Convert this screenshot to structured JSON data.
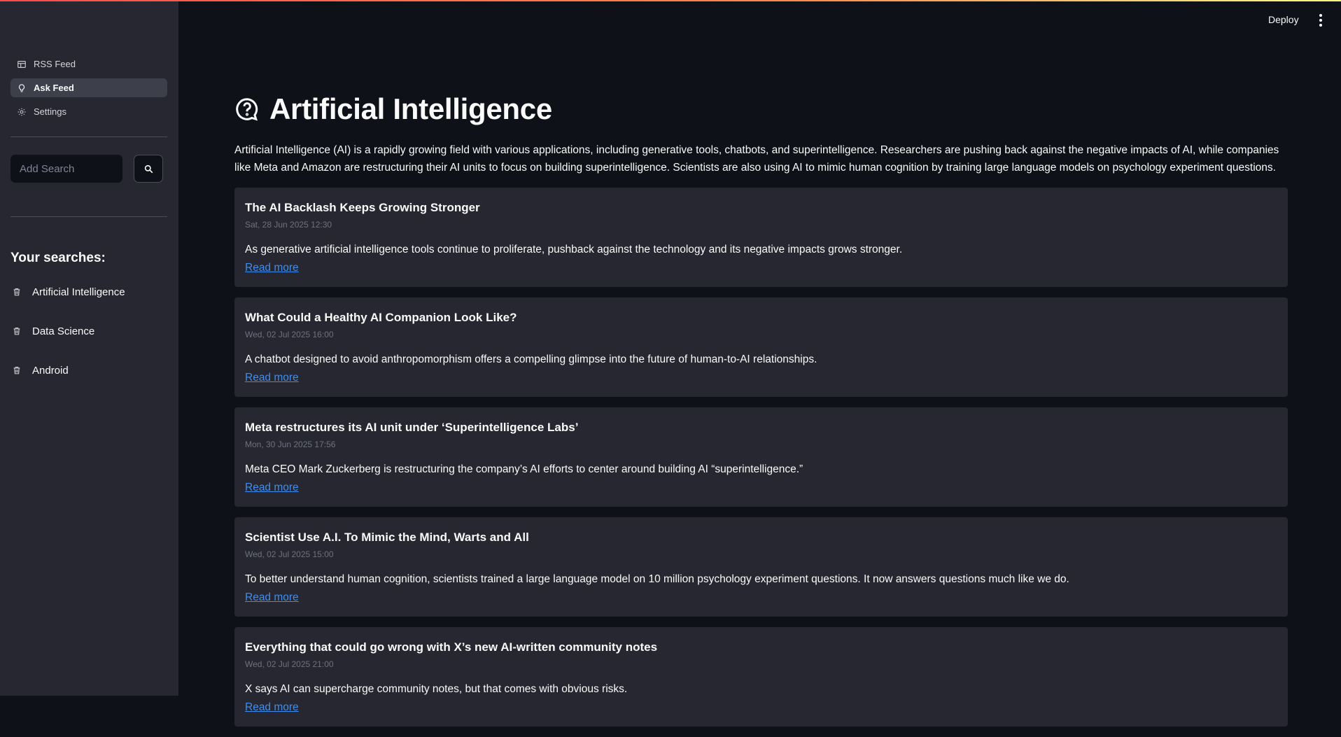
{
  "nav": {
    "items": [
      {
        "label": "RSS Feed",
        "icon": "table-icon",
        "active": false
      },
      {
        "label": "Ask Feed",
        "icon": "lightbulb-icon",
        "active": true
      },
      {
        "label": "Settings",
        "icon": "gear-icon",
        "active": false
      }
    ]
  },
  "search": {
    "placeholder": "Add Search",
    "value": ""
  },
  "sidebar": {
    "your_searches_heading": "Your searches:",
    "searches": [
      "Artificial Intelligence",
      "Data Science",
      "Android"
    ]
  },
  "header": {
    "deploy_label": "Deploy"
  },
  "main": {
    "title": "Artificial Intelligence",
    "summary": "Artificial Intelligence (AI) is a rapidly growing field with various applications, including generative tools, chatbots, and superintelligence. Researchers are pushing back against the negative impacts of AI, while companies like Meta and Amazon are restructuring their AI units to focus on building superintelligence. Scientists are also using AI to mimic human cognition by training large language models on psychology experiment questions.",
    "read_more_label": "Read more",
    "articles": [
      {
        "title": "The AI Backlash Keeps Growing Stronger",
        "date": "Sat, 28 Jun 2025 12:30",
        "description": "As generative artificial intelligence tools continue to proliferate, pushback against the technology and its negative impacts grows stronger."
      },
      {
        "title": "What Could a Healthy AI Companion Look Like?",
        "date": "Wed, 02 Jul 2025 16:00",
        "description": "A chatbot designed to avoid anthropomorphism offers a compelling glimpse into the future of human-to-AI relationships."
      },
      {
        "title": "Meta restructures its AI unit under ‘Superintelligence Labs’",
        "date": "Mon, 30 Jun 2025 17:56",
        "description": "Meta CEO Mark Zuckerberg is restructuring the company’s AI efforts to center around building  AI “superintelligence.”"
      },
      {
        "title": "Scientist Use A.I. To Mimic the Mind, Warts and All",
        "date": "Wed, 02 Jul 2025 15:00",
        "description": "To better understand human cognition, scientists trained a large language model on 10 million psychology experiment questions. It now answers questions much like we do."
      },
      {
        "title": "Everything that could go wrong with X’s new AI-written community notes",
        "date": "Wed, 02 Jul 2025 21:00",
        "description": "X says AI can supercharge community notes, but that comes with obvious risks."
      }
    ]
  },
  "colors": {
    "background": "#0e1117",
    "sidebar": "#262730",
    "card": "#262730",
    "link": "#3d8ef0",
    "muted": "#6f7180"
  }
}
